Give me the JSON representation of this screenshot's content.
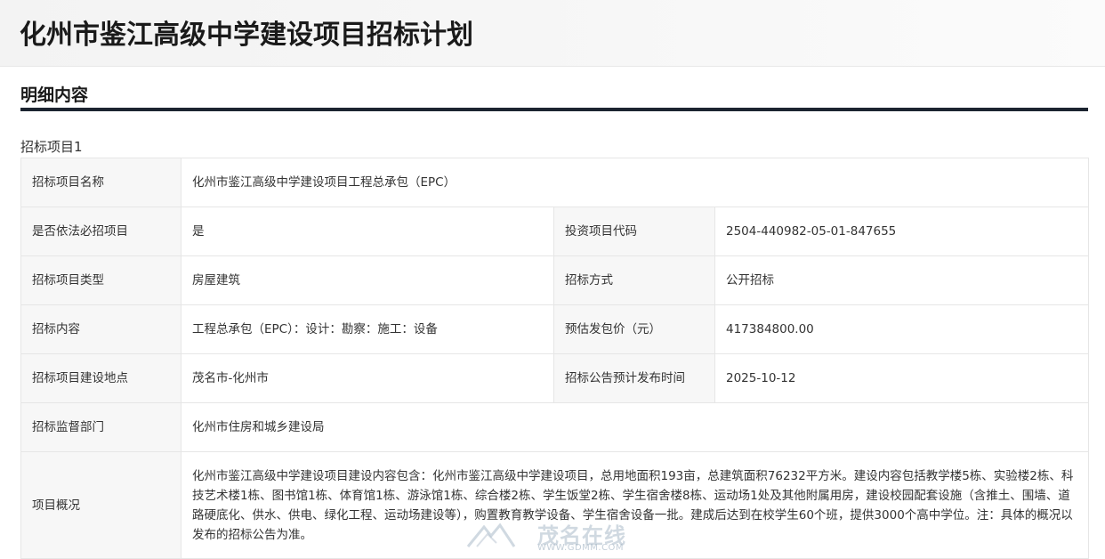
{
  "page": {
    "title": "化州市鉴江高级中学建设项目招标计划"
  },
  "section": {
    "title": "明细内容"
  },
  "item": {
    "title": "招标项目1"
  },
  "details": {
    "project_name": {
      "label": "招标项目名称",
      "value": "化州市鉴江高级中学建设项目工程总承包（EPC）"
    },
    "must_bid": {
      "label": "是否依法必招项目",
      "value": "是"
    },
    "invest_code": {
      "label": "投资项目代码",
      "value": "2504-440982-05-01-847655"
    },
    "project_type": {
      "label": "招标项目类型",
      "value": "房屋建筑"
    },
    "bid_method": {
      "label": "招标方式",
      "value": "公开招标"
    },
    "bid_content": {
      "label": "招标内容",
      "value": "工程总承包（EPC）：设计：勘察：施工：设备"
    },
    "est_price": {
      "label": "预估发包价（元）",
      "value": "417384800.00"
    },
    "location": {
      "label": "招标项目建设地点",
      "value": "茂名市-化州市"
    },
    "publish_time": {
      "label": "招标公告预计发布时间",
      "value": "2025-10-12"
    },
    "supervisor": {
      "label": "招标监督部门",
      "value": "化州市住房和城乡建设局"
    },
    "overview": {
      "label": "项目概况",
      "value": "化州市鉴江高级中学建设项目建设内容包含：化州市鉴江高级中学建设项目，总用地面积193亩，总建筑面积76232平方米。建设内容包括教学楼5栋、实验楼2栋、科技艺术楼1栋、图书馆1栋、体育馆1栋、游泳馆1栋、综合楼2栋、学生饭堂2栋、学生宿舍楼8栋、运动场1处及其他附属用房，建设校园配套设施（含推土、围墙、道路硬底化、供水、供电、绿化工程、运动场建设等），购置教育教学设备、学生宿舍设备一批。建成后达到在校学生60个班，提供3000个高中学位。注：具体的概况以发布的招标公告为准。"
    }
  },
  "watermark": {
    "text": "茂名在线",
    "url": "WWW.GDMM.COM"
  },
  "colors": {
    "key_cell_bg": "#f7f7f7",
    "border": "#e6e6e6",
    "rule": "#1c2430",
    "title": "#1a1a1a"
  }
}
